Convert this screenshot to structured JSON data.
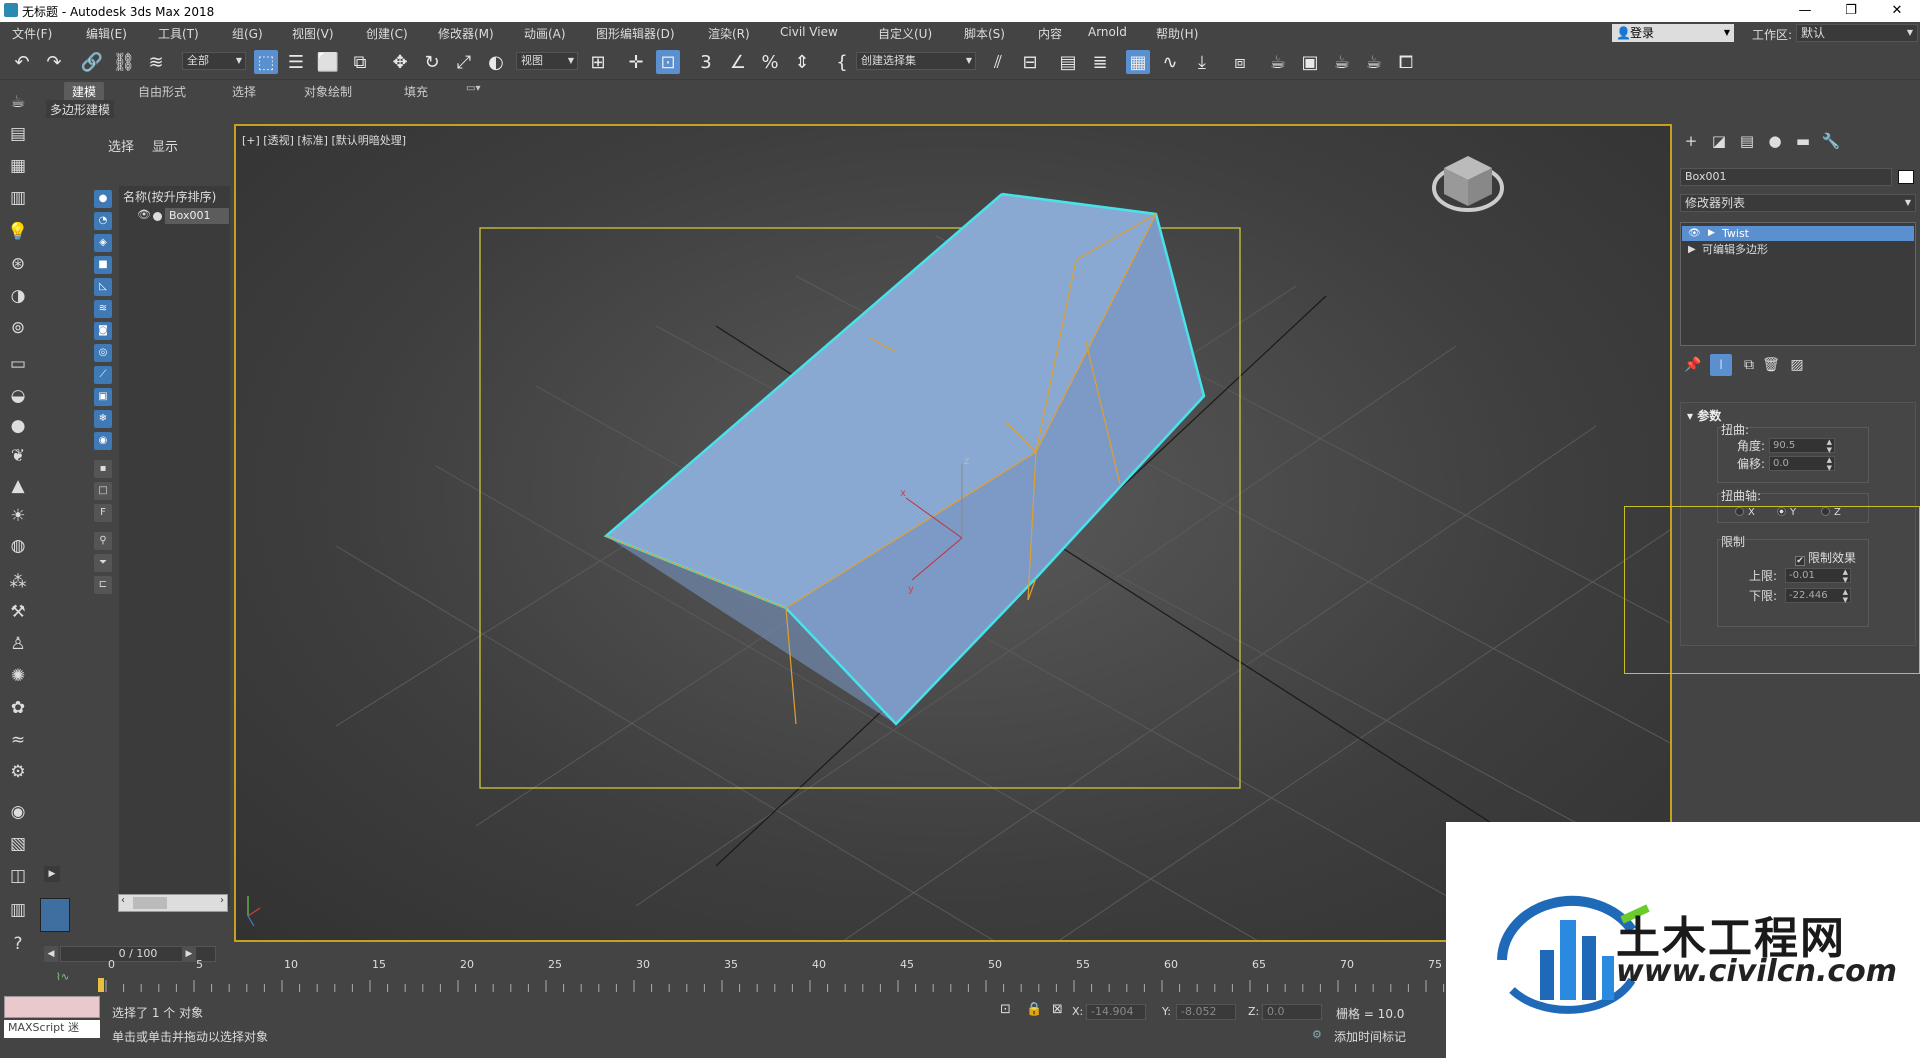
{
  "window": {
    "title": "无标题 - Autodesk 3ds Max 2018",
    "minimize": "—",
    "restore": "❐",
    "close": "✕"
  },
  "menu": [
    "文件(F)",
    "编辑(E)",
    "工具(T)",
    "组(G)",
    "视图(V)",
    "创建(C)",
    "修改器(M)",
    "动画(A)",
    "图形编辑器(D)",
    "渲染(R)",
    "Civil View",
    "自定义(U)",
    "脚本(S)",
    "内容",
    "Arnold",
    "帮助(H)"
  ],
  "login": "登录",
  "workspace": {
    "label": "工作区:",
    "value": "默认"
  },
  "toolbar": {
    "selection_filter": "全部",
    "ref_coord": "视图",
    "named_selection": "创建选择集"
  },
  "ribbon": {
    "tabs": [
      "建模",
      "自由形式",
      "选择",
      "对象绘制",
      "填充"
    ],
    "sub": "多边形建模"
  },
  "scene_explorer": {
    "tab_select": "选择",
    "tab_display": "显示",
    "header": "名称(按升序排序)",
    "object": "Box001"
  },
  "viewport": {
    "label": "[+] [透视] [标准] [默认明暗处理]",
    "axis_x": "x",
    "axis_y": "y",
    "axis_z": "z"
  },
  "command_panel": {
    "object_name": "Box001",
    "modifier_list": "修改器列表",
    "stack": [
      "Twist",
      "可编辑多边形"
    ],
    "rollout": "参数",
    "twist_group": "扭曲:",
    "angle_label": "角度:",
    "angle": "90.5",
    "bias_label": "偏移:",
    "bias": "0.0",
    "axis_group": "扭曲轴:",
    "axis_x": "X",
    "axis_y": "Y",
    "axis_z": "Z",
    "limit_group": "限制",
    "limit_effect": "限制效果",
    "upper_label": "上限:",
    "upper": "-0.01",
    "lower_label": "下限:",
    "lower": "-22.446"
  },
  "timeline": {
    "slider": "0 / 100",
    "ticks": [
      "0",
      "5",
      "10",
      "15",
      "20",
      "25",
      "30",
      "35",
      "40",
      "45",
      "50",
      "55",
      "60",
      "65",
      "70",
      "75"
    ]
  },
  "status": {
    "maxscript": "MAXScript 迷",
    "selected": "选择了 1 个 对象",
    "hint": "单击或单击并拖动以选择对象",
    "x_label": "X:",
    "x": "-14.904",
    "y_label": "Y:",
    "y": "-8.052",
    "z_label": "Z:",
    "z": "0.0",
    "grid": "栅格 = 10.0",
    "add_tag": "添加时间标记"
  },
  "watermark": {
    "brand": "土木工程网",
    "url": "www.civilcn.com"
  },
  "colors": {
    "accent": "#5a8fd0",
    "viewport_border": "#c8a020",
    "object_fill": "#8fb0d8",
    "selection_edge": "#4ae0e8",
    "wire": "#e0a030"
  }
}
